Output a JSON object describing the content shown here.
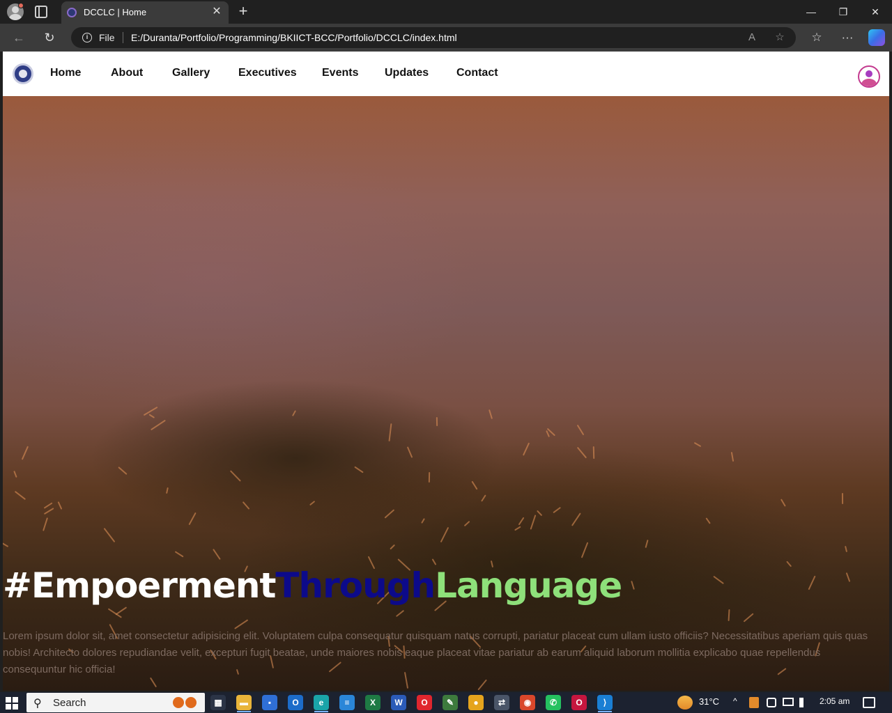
{
  "browser": {
    "tab_title": "DCCLC | Home",
    "close_glyph": "✕",
    "new_tab_glyph": "+",
    "window_controls": {
      "minimize": "—",
      "restore": "❐",
      "close": "✕"
    },
    "nav": {
      "back": "←",
      "refresh": "↻"
    },
    "address": {
      "scheme_label": "File",
      "url": "E:/Duranta/Portfolio/Programming/BKIICT-BCC/Portfolio/DCCLC/index.html"
    },
    "omni_icons": {
      "read_aloud": "A",
      "favorite": "☆"
    },
    "toolbar_icons": {
      "favorites": "☆",
      "more": "···"
    }
  },
  "site": {
    "nav_links": [
      {
        "label": "Home"
      },
      {
        "label": "About"
      },
      {
        "label": "Gallery"
      },
      {
        "label": "Executives"
      },
      {
        "label": "Events"
      },
      {
        "label": "Updates"
      },
      {
        "label": "Contact"
      }
    ],
    "hero": {
      "headline_part1": "#Empoerment",
      "headline_part2": "Through",
      "headline_part3": "Language",
      "headline_colors": {
        "part1": "#ffffff",
        "part2": "#0c0a8a",
        "part3": "#8ee07a"
      },
      "paragraph": "Lorem ipsum dolor sit, amet consectetur adipisicing elit. Voluptatem culpa consequatur quisquam natus corrupti, pariatur placeat cum ullam iusto officiis? Necessitatibus aperiam quis quas nobis! Architecto dolores repudiandae velit, excepturi fugit beatae, unde maiores nobis eaque placeat vitae pariatur ab earum aliquid laborum mollitia explicabo quae repellendus consequuntur hic officia!"
    }
  },
  "taskbar": {
    "search_label": "Search",
    "search_glyph": "⚲",
    "weather_temp": "31°C",
    "time": "2:05 am",
    "tray_chevron": "^",
    "apps": [
      {
        "icon": "task-view-icon",
        "glyph": "▦",
        "color": "#2b3446"
      },
      {
        "icon": "file-explorer-icon",
        "glyph": "▬",
        "color": "#e9b53a"
      },
      {
        "icon": "microsoft-store-icon",
        "glyph": "▪",
        "color": "#2f6fd6"
      },
      {
        "icon": "outlook-icon",
        "glyph": "O",
        "color": "#1c6cc9"
      },
      {
        "icon": "edge-icon",
        "glyph": "e",
        "color": "#1aa4a8"
      },
      {
        "icon": "app-icon",
        "glyph": "≡",
        "color": "#2a86d8"
      },
      {
        "icon": "excel-icon",
        "glyph": "X",
        "color": "#1e7a44"
      },
      {
        "icon": "word-icon",
        "glyph": "W",
        "color": "#2b5bb8"
      },
      {
        "icon": "opera-icon",
        "glyph": "O",
        "color": "#e0262e"
      },
      {
        "icon": "paint-icon",
        "glyph": "✎",
        "color": "#3d7a3d"
      },
      {
        "icon": "chrome-icon",
        "glyph": "●",
        "color": "#e5a41d"
      },
      {
        "icon": "network-tool-icon",
        "glyph": "⇄",
        "color": "#4a5568"
      },
      {
        "icon": "browser-icon",
        "glyph": "◉",
        "color": "#d9472b"
      },
      {
        "icon": "whatsapp-icon",
        "glyph": "✆",
        "color": "#25c160"
      },
      {
        "icon": "opera-gx-icon",
        "glyph": "O",
        "color": "#c5163f"
      },
      {
        "icon": "vscode-icon",
        "glyph": "⟩",
        "color": "#1a7fd4"
      }
    ]
  },
  "colors": {
    "navbar_bg": "#ffffff",
    "nav_text": "#111111",
    "paragraph_text": "#7d6a60",
    "chrome_dark": "#202020",
    "chrome_mid": "#3b3b3b"
  }
}
